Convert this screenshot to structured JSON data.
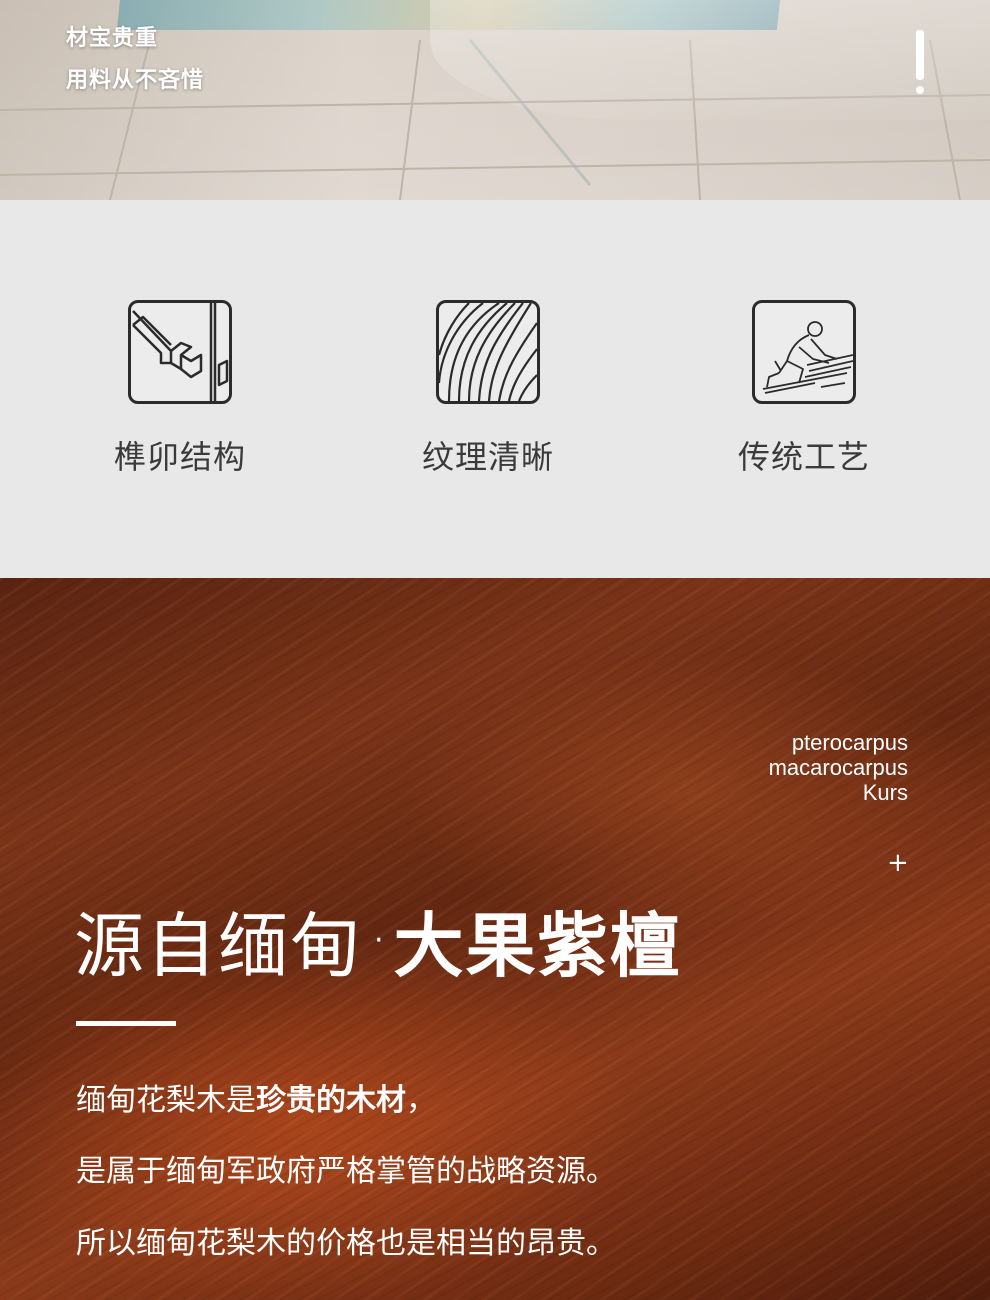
{
  "banner": {
    "line1": "材宝贵重",
    "line2": "用料从不吝惜"
  },
  "features": [
    {
      "label": "榫卯结构",
      "icon": "mortise-tenon-icon"
    },
    {
      "label": "纹理清晰",
      "icon": "wood-grain-icon"
    },
    {
      "label": "传统工艺",
      "icon": "craftsman-icon"
    }
  ],
  "wood_section": {
    "latin_line1": "pterocarpus",
    "latin_line2": "macarocarpus",
    "latin_line3": "Kurs",
    "plus": "+",
    "title_light": "源自缅甸",
    "title_dot": "·",
    "title_bold": "大果紫檀",
    "para1_normal": "缅甸花梨木是",
    "para1_bold": "珍贵的木材",
    "para1_end": "，",
    "para2": "是属于缅甸军政府严格掌管的战略资源。",
    "para3": "所以缅甸花梨木的价格也是相当的昂贵。"
  },
  "colors": {
    "feature_bg": "#e8e8e8",
    "icon_stroke": "#2b2b2b",
    "wood_base": "#6e2b12",
    "text_white": "#ffffff"
  }
}
